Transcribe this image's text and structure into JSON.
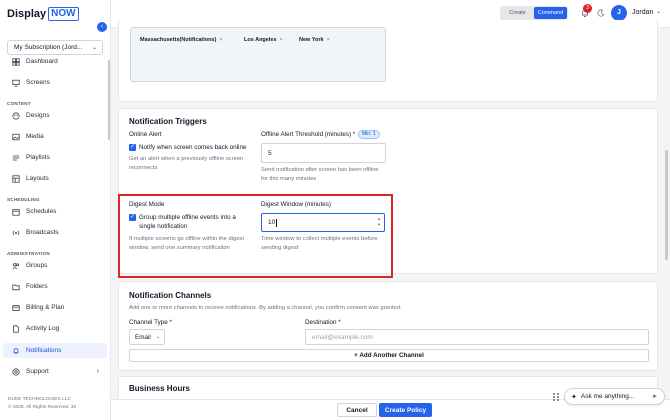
{
  "brand": {
    "name": "Display",
    "name_box": "NOW"
  },
  "sidebar": {
    "subscription": "My Subscription (Jord...",
    "items": [
      {
        "label": "Dashboard",
        "icon": "dashboard-icon"
      },
      {
        "label": "Screens",
        "icon": "monitor-icon"
      },
      {
        "label": "Designs",
        "icon": "palette-icon"
      },
      {
        "label": "Media",
        "icon": "image-icon"
      },
      {
        "label": "Playlists",
        "icon": "list-icon"
      },
      {
        "label": "Layouts",
        "icon": "layout-icon"
      },
      {
        "label": "Schedules",
        "icon": "calendar-icon"
      },
      {
        "label": "Broadcasts",
        "icon": "broadcast-icon"
      },
      {
        "label": "Groups",
        "icon": "users-icon"
      },
      {
        "label": "Folders",
        "icon": "folder-icon"
      },
      {
        "label": "Billing & Plan",
        "icon": "card-icon"
      },
      {
        "label": "Activity Log",
        "icon": "file-icon"
      },
      {
        "label": "Notifications",
        "icon": "bell-icon",
        "active": true
      },
      {
        "label": "Support",
        "icon": "help-icon"
      }
    ],
    "sections": {
      "content": "CONTENT",
      "scheduling": "SCHEDULING",
      "administration": "ADMINISTRATION"
    },
    "footer_company": "DUKE TECHNOLOGIES LLC",
    "footer_copyright": "© 2026. All Rights Reserved. 32"
  },
  "topbar": {
    "mode_create": "Create",
    "mode_command": "Command",
    "notification_count": "3",
    "avatar_initial": "J",
    "user_name": "Jordan"
  },
  "locations": {
    "tags": [
      "Massachusetts(Notifications)",
      "Los Angeles",
      "New York"
    ],
    "remove_symbol": "×"
  },
  "triggers": {
    "title": "Notification Triggers",
    "online_alert": {
      "label": "Online Alert",
      "checkbox_label": "Notify when screen comes back online",
      "help": "Get an alert when a previously offline screen reconnects"
    },
    "offline_threshold": {
      "label": "Offline Alert Threshold (minutes) *",
      "pill": "Min: 1",
      "value": "5",
      "help": "Send notification after screen has been offline for this many minutes"
    },
    "digest_mode": {
      "label": "Digest Mode",
      "checkbox_label": "Group multiple offline events into a single notification",
      "help": "If multiple screens go offline within the digest window, send one summary notification"
    },
    "digest_window": {
      "label": "Digest Window (minutes)",
      "value": "10",
      "help": "Time window to collect multiple events before sending digest"
    }
  },
  "channels": {
    "title": "Notification Channels",
    "description": "Add one or more channels to receive notifications. By adding a channel, you confirm consent was granted.",
    "channel_type_label": "Channel Type *",
    "channel_type_value": "Email",
    "destination_label": "Destination *",
    "destination_placeholder": "email@example.com",
    "add_button": "+ Add Another Channel"
  },
  "business_hours": {
    "title": "Business Hours"
  },
  "footer": {
    "cancel": "Cancel",
    "create": "Create Policy"
  },
  "assistant": {
    "placeholder": "Ask me anything..."
  },
  "colors": {
    "accent": "#2563eb",
    "highlight": "#dc2626",
    "badge": "#dc2626"
  }
}
